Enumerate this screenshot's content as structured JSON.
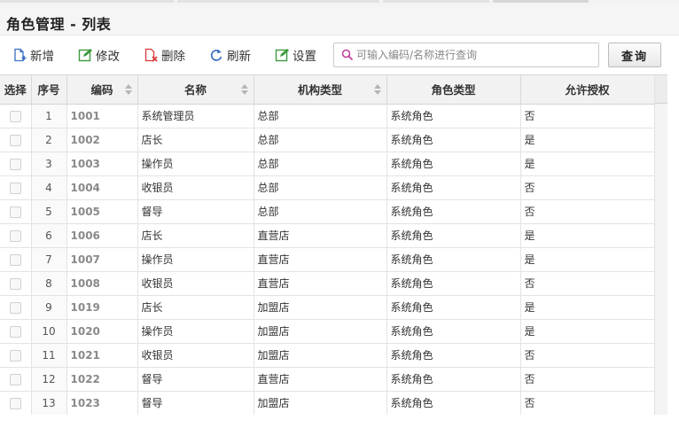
{
  "window": {
    "title": "角色管理 - 列表"
  },
  "toolbar": {
    "buttons": [
      {
        "label": "新增",
        "icon": "add-document-icon",
        "color": "#3a6fc4"
      },
      {
        "label": "修改",
        "icon": "edit-icon",
        "color": "#3d9a3d"
      },
      {
        "label": "删除",
        "icon": "delete-document-icon",
        "color": "#d93a3a"
      },
      {
        "label": "刷新",
        "icon": "refresh-icon",
        "color": "#3a6fc4"
      },
      {
        "label": "设置",
        "icon": "settings-edit-icon",
        "color": "#3d9a3d"
      }
    ],
    "search_placeholder": "可输入编码/名称进行查询",
    "search_value": "",
    "query_label": "查询"
  },
  "table": {
    "columns": [
      "选择",
      "序号",
      "编码",
      "名称",
      "机构类型",
      "角色类型",
      "允许授权"
    ],
    "sortable": [
      false,
      false,
      true,
      true,
      true,
      false,
      false
    ],
    "rows": [
      {
        "index": "1",
        "code": "1001",
        "name": "系统管理员",
        "org_type": "总部",
        "role_type": "系统角色",
        "authorize": "否"
      },
      {
        "index": "2",
        "code": "1002",
        "name": "店长",
        "org_type": "总部",
        "role_type": "系统角色",
        "authorize": "是"
      },
      {
        "index": "3",
        "code": "1003",
        "name": "操作员",
        "org_type": "总部",
        "role_type": "系统角色",
        "authorize": "是"
      },
      {
        "index": "4",
        "code": "1004",
        "name": "收银员",
        "org_type": "总部",
        "role_type": "系统角色",
        "authorize": "否"
      },
      {
        "index": "5",
        "code": "1005",
        "name": "督导",
        "org_type": "总部",
        "role_type": "系统角色",
        "authorize": "否"
      },
      {
        "index": "6",
        "code": "1006",
        "name": "店长",
        "org_type": "直营店",
        "role_type": "系统角色",
        "authorize": "是"
      },
      {
        "index": "7",
        "code": "1007",
        "name": "操作员",
        "org_type": "直营店",
        "role_type": "系统角色",
        "authorize": "是"
      },
      {
        "index": "8",
        "code": "1008",
        "name": "收银员",
        "org_type": "直营店",
        "role_type": "系统角色",
        "authorize": "否"
      },
      {
        "index": "9",
        "code": "1019",
        "name": "店长",
        "org_type": "加盟店",
        "role_type": "系统角色",
        "authorize": "是"
      },
      {
        "index": "10",
        "code": "1020",
        "name": "操作员",
        "org_type": "加盟店",
        "role_type": "系统角色",
        "authorize": "是"
      },
      {
        "index": "11",
        "code": "1021",
        "name": "收银员",
        "org_type": "加盟店",
        "role_type": "系统角色",
        "authorize": "否"
      },
      {
        "index": "12",
        "code": "1022",
        "name": "督导",
        "org_type": "直营店",
        "role_type": "系统角色",
        "authorize": "否"
      },
      {
        "index": "13",
        "code": "1023",
        "name": "督导",
        "org_type": "加盟店",
        "role_type": "系统角色",
        "authorize": "否"
      }
    ]
  }
}
